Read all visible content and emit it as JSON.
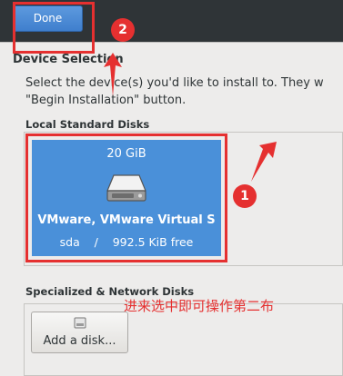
{
  "header": {
    "done_label": "Done"
  },
  "section": {
    "title": "Device Selection",
    "intro_line1": "Select the device(s) you'd like to install to.  They w",
    "intro_line2": "\"Begin Installation\" button."
  },
  "local_disks": {
    "label": "Local Standard Disks",
    "disks": [
      {
        "size": "20 GiB",
        "name": "VMware, VMware Virtual S",
        "device": "sda",
        "free": "992.5 KiB free",
        "details": "sda    /    992.5 KiB free",
        "icon": "hard-drive-icon"
      }
    ]
  },
  "specialized": {
    "label": "Specialized & Network Disks",
    "add_disk_label": "Add a disk...",
    "icon": "add-disk-icon"
  },
  "annotations": {
    "badge_1": "1",
    "badge_2": "2",
    "caption": "进来选中即可操作第二布",
    "color": "#e53030"
  },
  "colors": {
    "header_bg": "#2f3437",
    "done_button": "#4a88d6",
    "disk_selected": "#4a90d9",
    "background": "#edeceb"
  }
}
